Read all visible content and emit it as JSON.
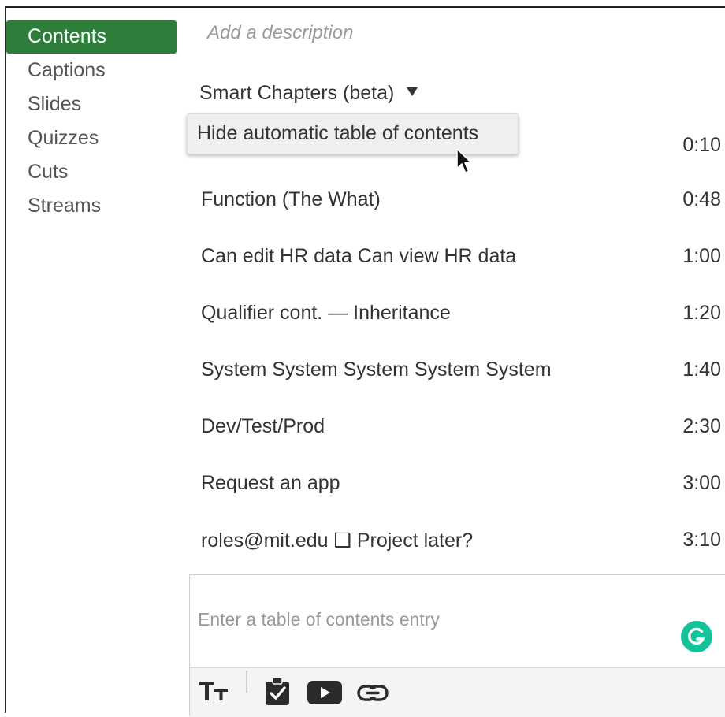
{
  "sidebar": {
    "items": [
      {
        "label": "Contents",
        "active": true
      },
      {
        "label": "Captions"
      },
      {
        "label": "Slides"
      },
      {
        "label": "Quizzes"
      },
      {
        "label": "Cuts"
      },
      {
        "label": "Streams"
      }
    ]
  },
  "main": {
    "description_placeholder": "Add a description",
    "smart_chapters_label": "Smart Chapters (beta)",
    "dropdown": {
      "item_label": "Hide automatic table of contents"
    },
    "toc_entries": [
      {
        "title": "",
        "time": "0:10"
      },
      {
        "title": "Function (The What)",
        "time": "0:48"
      },
      {
        "title": "Can edit HR data Can view HR data",
        "time": "1:00"
      },
      {
        "title": "Qualifier cont. — Inheritance",
        "time": "1:20"
      },
      {
        "title": "System System System System System",
        "time": "1:40"
      },
      {
        "title": "Dev/Test/Prod",
        "time": "2:30"
      },
      {
        "title": "Request an app",
        "time": "3:00"
      },
      {
        "title": "roles@mit.edu ❑ Project later?",
        "time": "3:10"
      }
    ]
  },
  "editor": {
    "placeholder": "Enter a table of contents entry",
    "value": "",
    "toolbar": {
      "text_size_icon": "text-size-icon",
      "quiz_icon": "clipboard-check-icon",
      "video_icon": "youtube-play-icon",
      "link_icon": "link-icon"
    }
  },
  "colors": {
    "accent_green": "#2e7d3a",
    "grammarly_green": "#15c39a",
    "text": "#333333",
    "muted": "#9a9a9a"
  }
}
